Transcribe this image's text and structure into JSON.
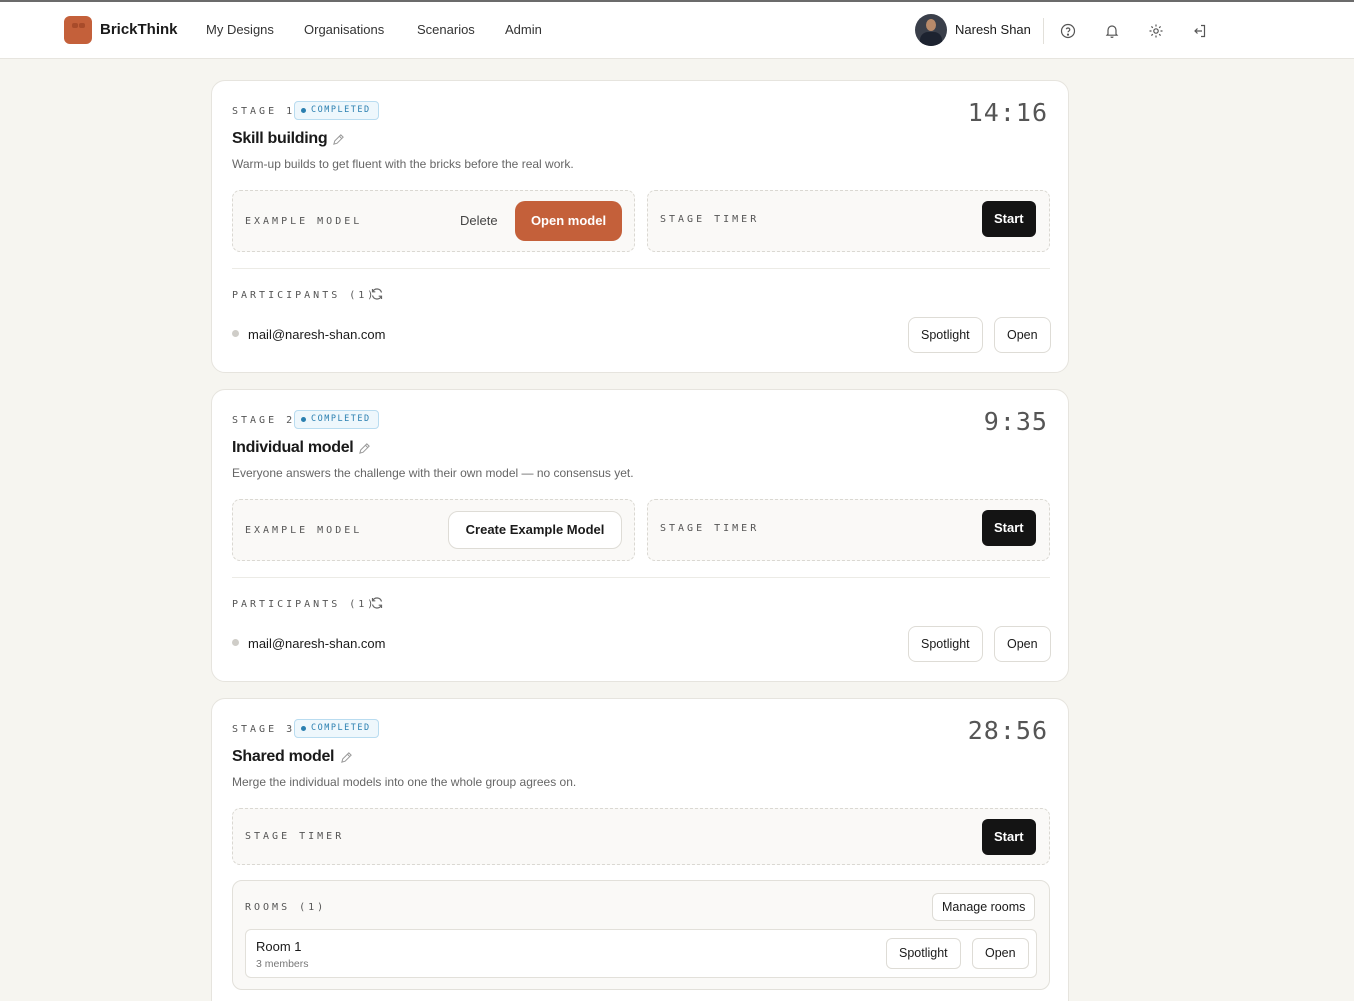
{
  "app": {
    "name": "BrickThink"
  },
  "nav": {
    "items": [
      "My Designs",
      "Organisations",
      "Scenarios",
      "Admin"
    ]
  },
  "user": {
    "name": "Naresh Shan"
  },
  "icons": {
    "help": "help-circle-icon",
    "notifications": "bell-icon",
    "settings": "gear-icon",
    "logout": "logout-icon"
  },
  "colors": {
    "accent": "#c4603a",
    "completed": "#2a7fb0",
    "dark": "#141414"
  },
  "stages": [
    {
      "label": "STAGE 1",
      "status": "COMPLETED",
      "time": "14:16",
      "title": "Skill building",
      "description": "Warm-up builds to get fluent with the bricks before the real work.",
      "example_model_label": "EXAMPLE MODEL",
      "delete_label": "Delete",
      "open_model_label": "Open model",
      "timer_label": "STAGE TIMER",
      "start_label": "Start",
      "participants_label": "PARTICIPANTS (1)",
      "participants": [
        {
          "email": "mail@naresh-shan.com",
          "spotlight": "Spotlight",
          "open": "Open"
        }
      ]
    },
    {
      "label": "STAGE 2",
      "status": "COMPLETED",
      "time": "9:35",
      "title": "Individual model",
      "description": "Everyone answers the challenge with their own model — no consensus yet.",
      "example_model_label": "EXAMPLE MODEL",
      "create_label": "Create Example Model",
      "timer_label": "STAGE TIMER",
      "start_label": "Start",
      "participants_label": "PARTICIPANTS (1)",
      "participants": [
        {
          "email": "mail@naresh-shan.com",
          "spotlight": "Spotlight",
          "open": "Open"
        }
      ]
    },
    {
      "label": "STAGE 3",
      "status": "COMPLETED",
      "time": "28:56",
      "title": "Shared model",
      "description": "Merge the individual models into one the whole group agrees on.",
      "timer_label": "STAGE TIMER",
      "start_label": "Start",
      "rooms_label": "ROOMS (1)",
      "manage_rooms_label": "Manage rooms",
      "rooms": [
        {
          "name": "Room 1",
          "members": "3 members",
          "spotlight": "Spotlight",
          "open": "Open"
        }
      ]
    }
  ]
}
